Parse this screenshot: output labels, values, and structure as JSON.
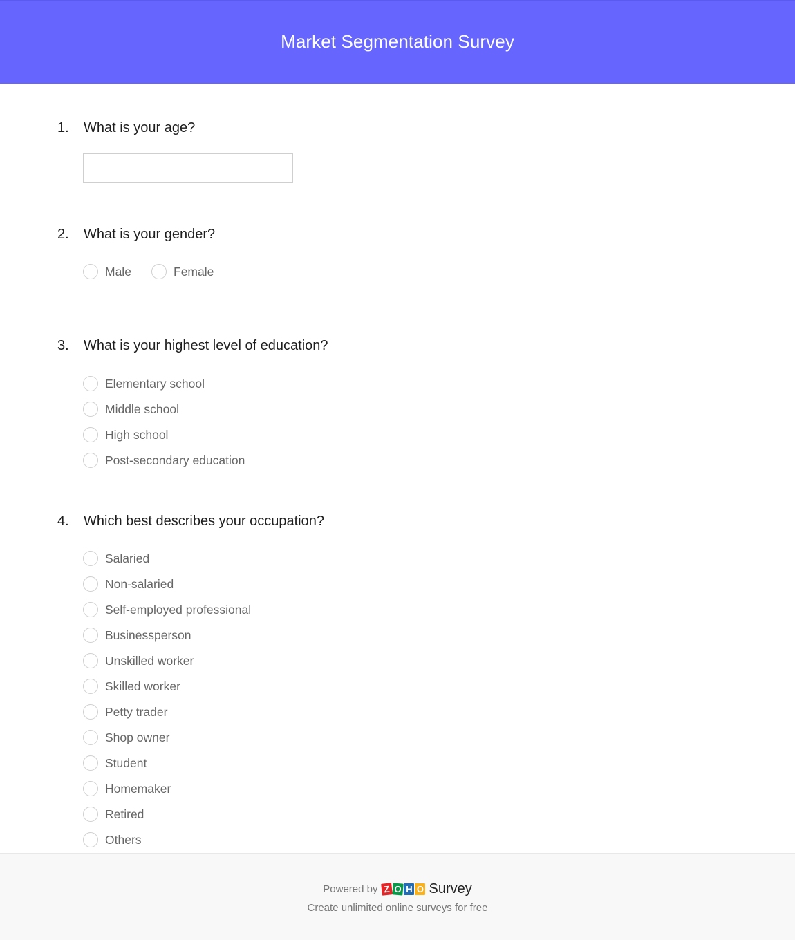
{
  "header": {
    "title": "Market Segmentation Survey",
    "background_color": "#6666ff"
  },
  "questions": [
    {
      "number": "1.",
      "text": "What is your age?",
      "type": "text",
      "value": "",
      "placeholder": ""
    },
    {
      "number": "2.",
      "text": "What is your gender?",
      "type": "radio-inline",
      "options": [
        "Male",
        "Female"
      ]
    },
    {
      "number": "3.",
      "text": "What is your highest level of education?",
      "type": "radio",
      "options": [
        "Elementary school",
        "Middle school",
        "High school",
        "Post-secondary education"
      ]
    },
    {
      "number": "4.",
      "text": "Which best describes your occupation?",
      "type": "radio",
      "options": [
        "Salaried",
        "Non-salaried",
        "Self-employed professional",
        "Businessperson",
        "Unskilled worker",
        "Skilled worker",
        "Petty trader",
        "Shop owner",
        "Student",
        "Homemaker",
        "Retired",
        "Others"
      ]
    }
  ],
  "footer": {
    "powered_by": "Powered by",
    "logo_letters": [
      "Z",
      "O",
      "H",
      "O"
    ],
    "logo_colors": [
      "#e42527",
      "#089949",
      "#226db4",
      "#f9b21d"
    ],
    "product": "Survey",
    "tagline": "Create unlimited online surveys for free"
  }
}
